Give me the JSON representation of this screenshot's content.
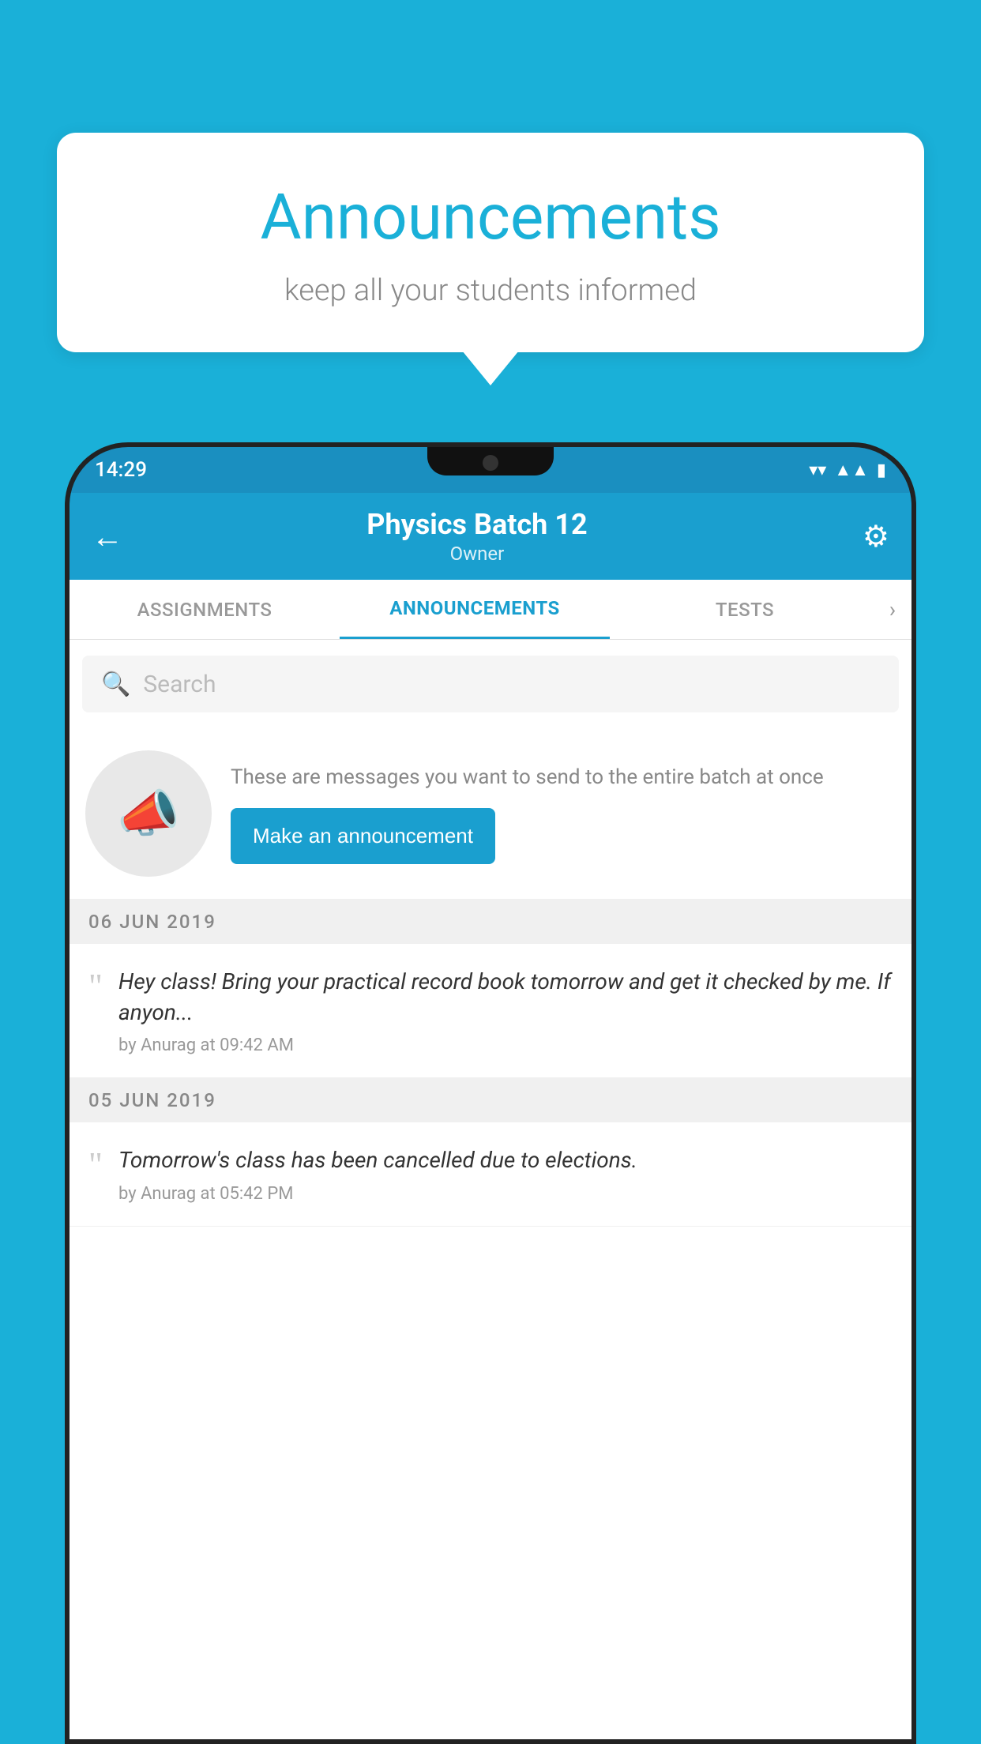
{
  "bubble": {
    "title": "Announcements",
    "subtitle": "keep all your students informed"
  },
  "status_bar": {
    "time": "14:29",
    "icons": [
      "wifi",
      "signal",
      "battery"
    ]
  },
  "app_bar": {
    "title": "Physics Batch 12",
    "subtitle": "Owner",
    "back_label": "←",
    "settings_label": "⚙"
  },
  "tabs": [
    {
      "label": "ASSIGNMENTS",
      "active": false
    },
    {
      "label": "ANNOUNCEMENTS",
      "active": true
    },
    {
      "label": "TESTS",
      "active": false
    }
  ],
  "search": {
    "placeholder": "Search"
  },
  "empty_state": {
    "description": "These are messages you want to send to the entire batch at once",
    "button_label": "Make an announcement"
  },
  "announcements": [
    {
      "date": "06  JUN  2019",
      "text": "Hey class! Bring your practical record book tomorrow and get it checked by me. If anyon...",
      "meta": "by Anurag at 09:42 AM"
    },
    {
      "date": "05  JUN  2019",
      "text": "Tomorrow's class has been cancelled due to elections.",
      "meta": "by Anurag at 05:42 PM"
    }
  ]
}
